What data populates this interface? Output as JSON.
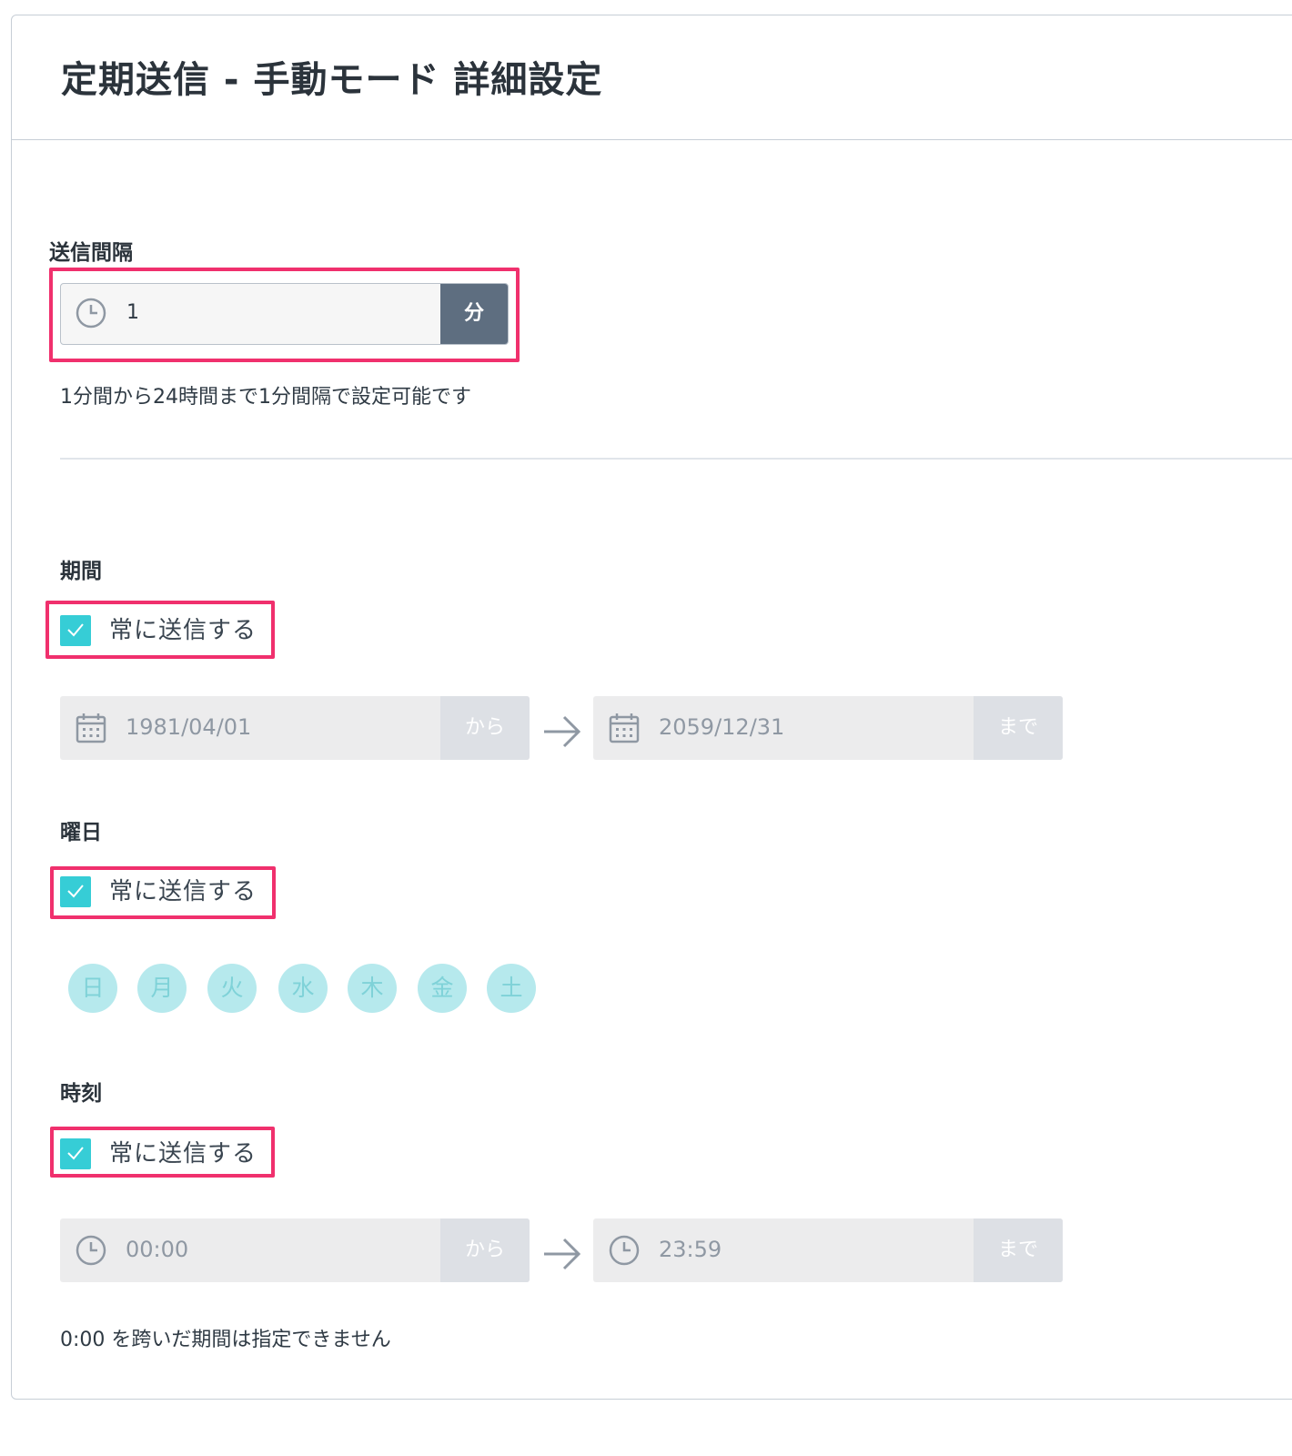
{
  "page": {
    "title": "定期送信 - 手動モード 詳細設定"
  },
  "interval": {
    "label": "送信間隔",
    "value": "1",
    "unit": "分",
    "hint": "1分間から24時間まで1分間隔で設定可能です"
  },
  "period": {
    "label": "期間",
    "always_label": "常に送信する",
    "always_checked": true,
    "start_date": "1981/04/01",
    "start_suffix": "から",
    "end_date": "2059/12/31",
    "end_suffix": "まで"
  },
  "weekdays": {
    "label": "曜日",
    "always_label": "常に送信する",
    "always_checked": true,
    "days": [
      "日",
      "月",
      "火",
      "水",
      "木",
      "金",
      "土"
    ]
  },
  "time": {
    "label": "時刻",
    "always_label": "常に送信する",
    "always_checked": true,
    "start_time": "00:00",
    "start_suffix": "から",
    "end_time": "23:59",
    "end_suffix": "まで",
    "hint": "0:00 を跨いだ期間は指定できません"
  },
  "colors": {
    "highlight": "#f0306d",
    "checkbox": "#36cdd6",
    "unit_button": "#5e6e80",
    "day_circle": "#b6e9ed"
  },
  "icons": [
    "clock-icon",
    "calendar-icon",
    "checkmark-icon",
    "arrow-right-icon"
  ]
}
